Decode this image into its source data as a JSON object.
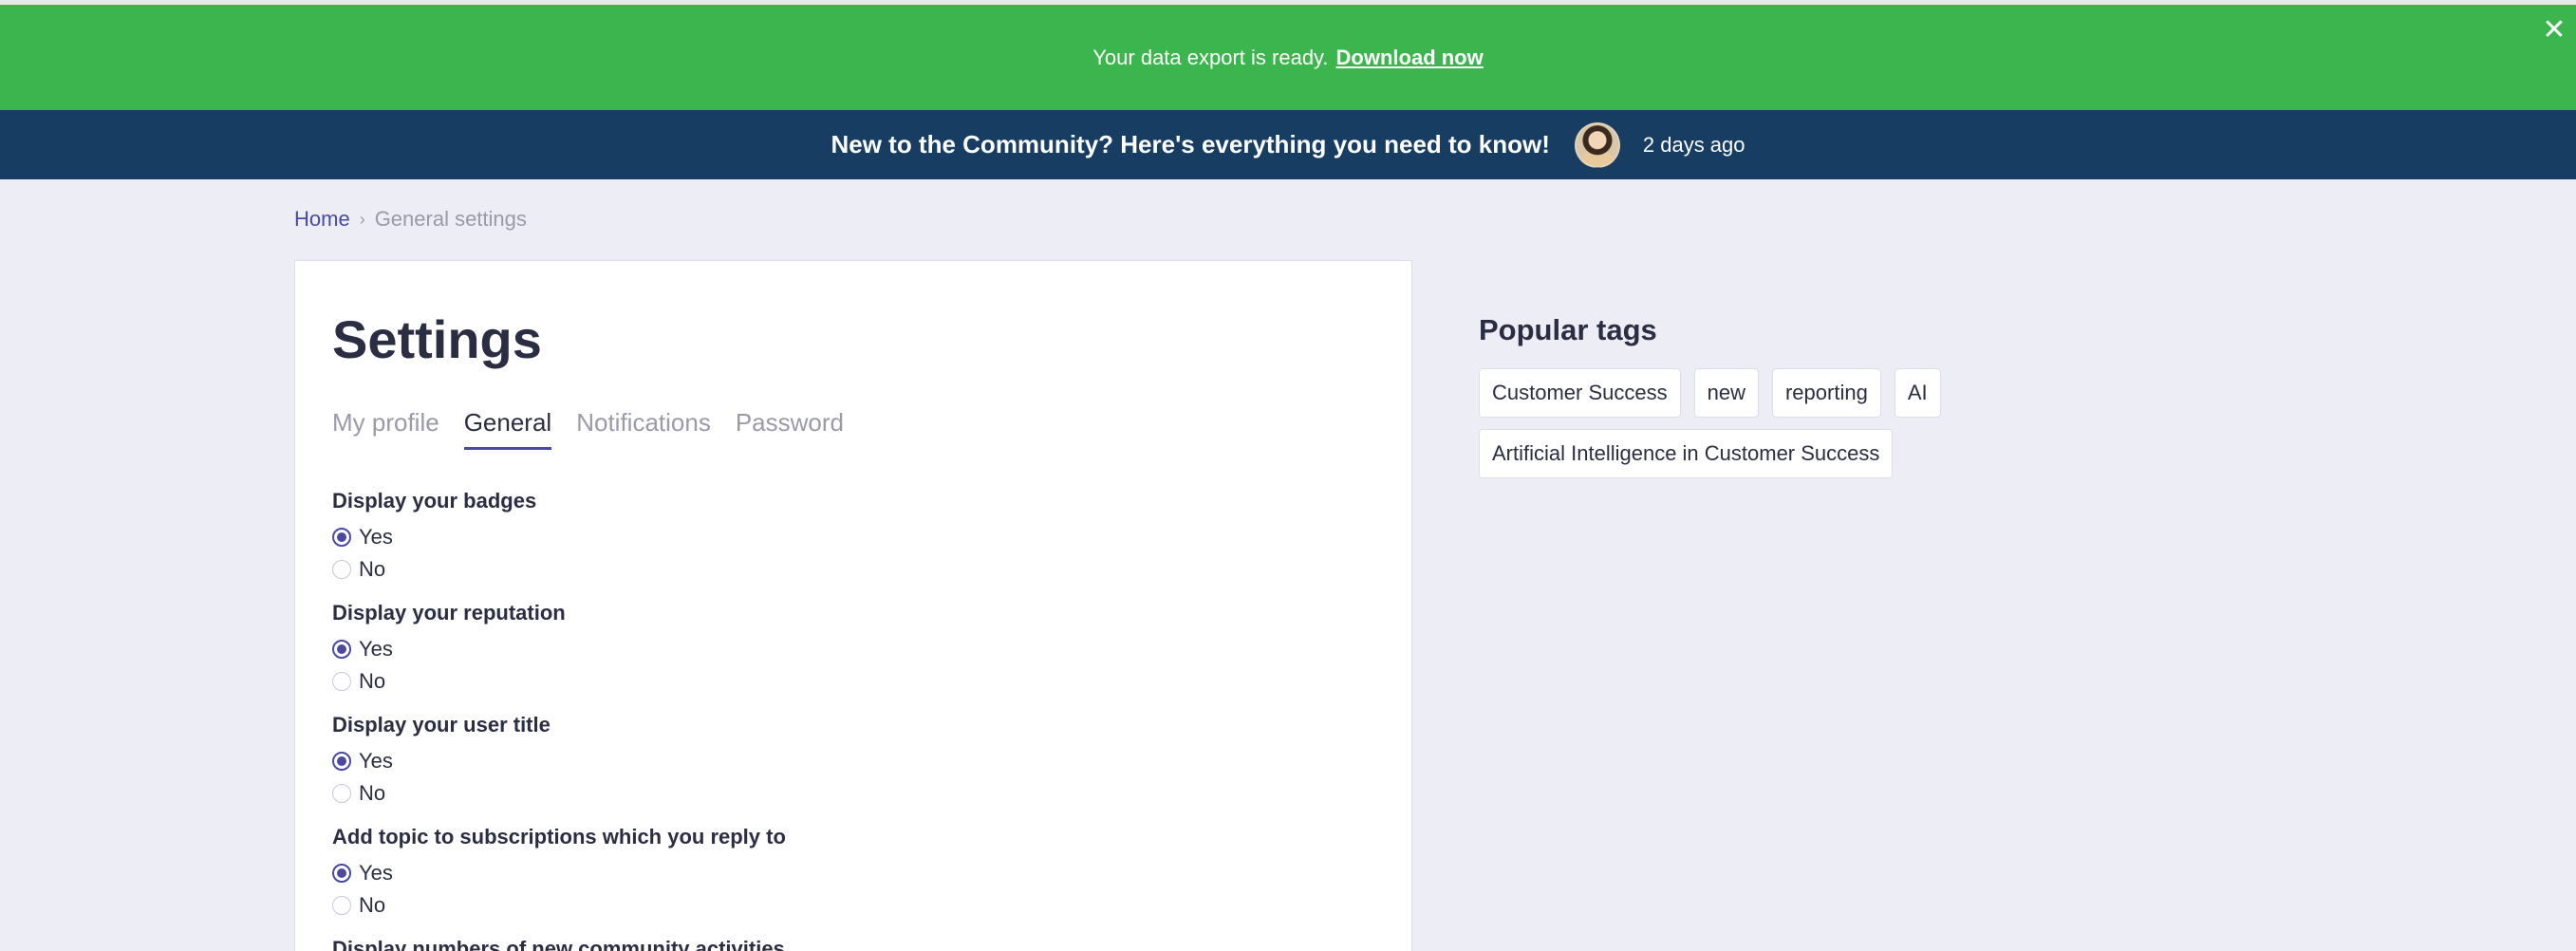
{
  "banner": {
    "message": "Your data export is ready.",
    "link_label": "Download now",
    "close_glyph": "✕",
    "bg_color": "#3db54e"
  },
  "announcement": {
    "title": "New to the Community? Here's everything you need to know!",
    "time": "2 days ago",
    "bg_color": "#173d63"
  },
  "breadcrumb": {
    "home": "Home",
    "separator": "›",
    "current": "General settings"
  },
  "settings": {
    "title": "Settings",
    "tabs": [
      {
        "label": "My profile",
        "active": false
      },
      {
        "label": "General",
        "active": true
      },
      {
        "label": "Notifications",
        "active": false
      },
      {
        "label": "Password",
        "active": false
      }
    ],
    "options": [
      {
        "label": "Display your badges",
        "choices": [
          {
            "label": "Yes",
            "checked": true
          },
          {
            "label": "No",
            "checked": false
          }
        ]
      },
      {
        "label": "Display your reputation",
        "choices": [
          {
            "label": "Yes",
            "checked": true
          },
          {
            "label": "No",
            "checked": false
          }
        ]
      },
      {
        "label": "Display your user title",
        "choices": [
          {
            "label": "Yes",
            "checked": true
          },
          {
            "label": "No",
            "checked": false
          }
        ]
      },
      {
        "label": "Add topic to subscriptions which you reply to",
        "choices": [
          {
            "label": "Yes",
            "checked": true
          },
          {
            "label": "No",
            "checked": false
          }
        ]
      },
      {
        "label": "Display numbers of new community activities",
        "choices": []
      }
    ]
  },
  "popular_tags": {
    "title": "Popular tags",
    "tags": [
      "Customer Success",
      "new",
      "reporting",
      "AI",
      "Artificial Intelligence in Customer Success"
    ]
  },
  "colors": {
    "accent": "#4b4aa0",
    "page_bg": "#ecedf5"
  }
}
